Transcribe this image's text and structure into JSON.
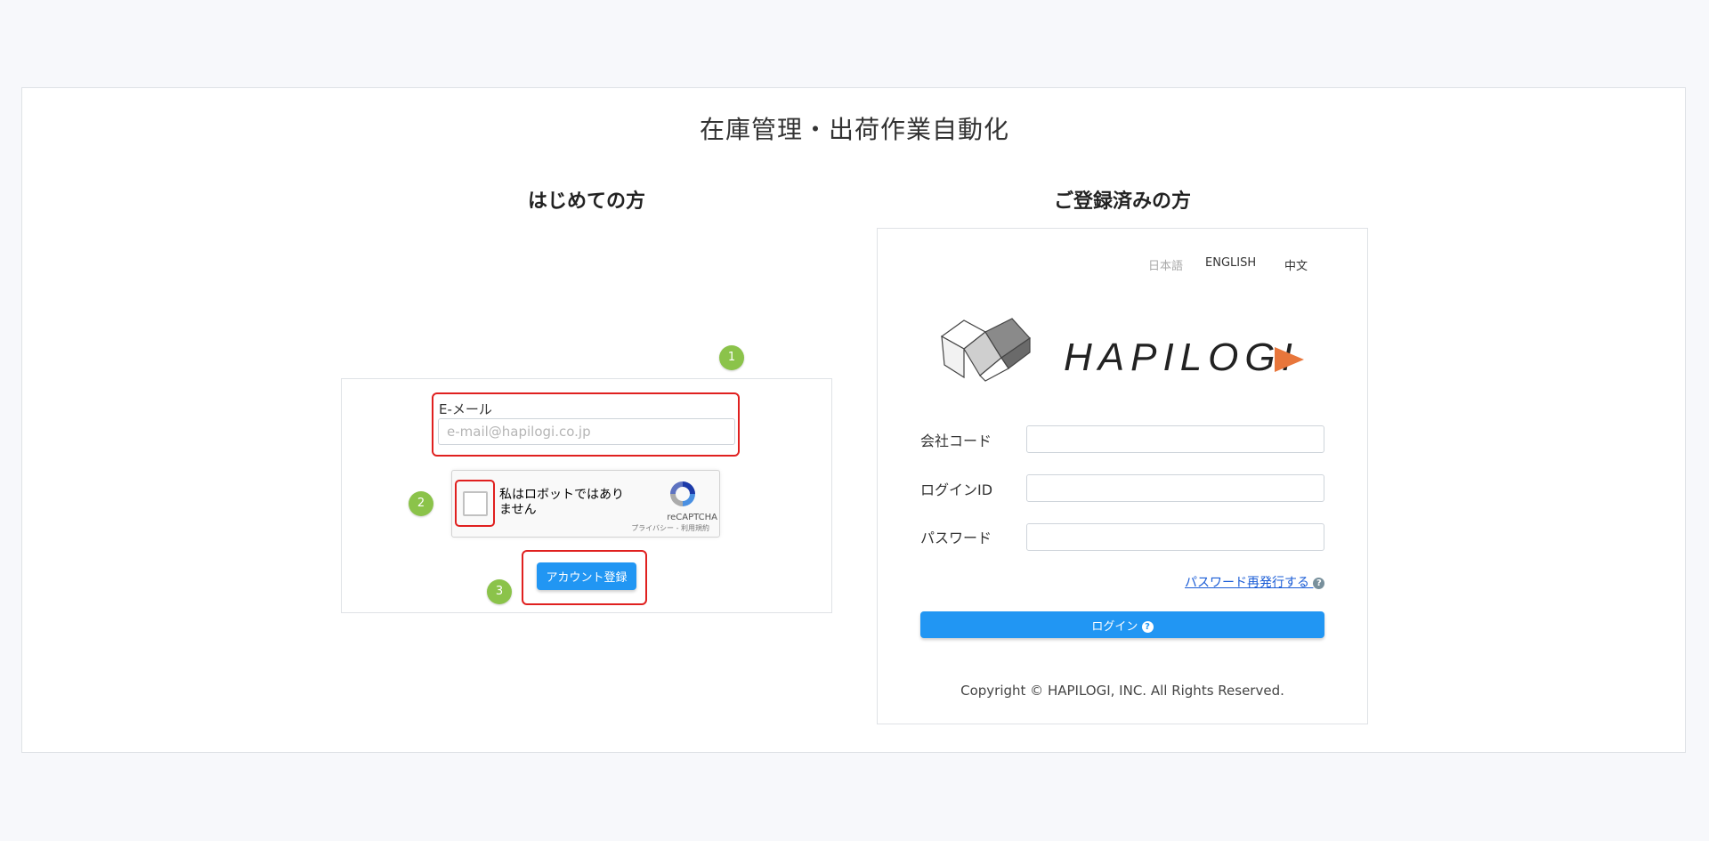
{
  "page_title": "在庫管理・出荷作業自動化",
  "signup": {
    "heading": "はじめての方",
    "email_label": "E-メール",
    "email_placeholder": "e-mail@hapilogi.co.jp",
    "email_value": "",
    "recaptcha": {
      "label": "私はロボットではありません",
      "brand": "reCAPTCHA",
      "terms": "プライバシー - 利用規約",
      "checked": false
    },
    "submit_label": "アカウント登録",
    "steps": [
      "1",
      "2",
      "3"
    ]
  },
  "login": {
    "heading": "ご登録済みの方",
    "languages": [
      {
        "label": "日本語",
        "active": false
      },
      {
        "label": "ENGLISH",
        "active": true
      },
      {
        "label": "中文",
        "active": true
      }
    ],
    "logo_text": "HAPILOGI",
    "fields": [
      {
        "label": "会社コード",
        "value": ""
      },
      {
        "label": "ログインID",
        "value": ""
      },
      {
        "label": "パスワード",
        "value": ""
      }
    ],
    "reset_link": "パスワード再発行する",
    "help_glyph": "?",
    "submit_label": "ログイン",
    "copyright": "Copyright © HAPILOGI, INC. All Rights Reserved."
  },
  "colors": {
    "accent": "#2196f3",
    "highlight": "#e0201f",
    "step_badge": "#8bc34a",
    "logo_arrow": "#e8763b"
  }
}
